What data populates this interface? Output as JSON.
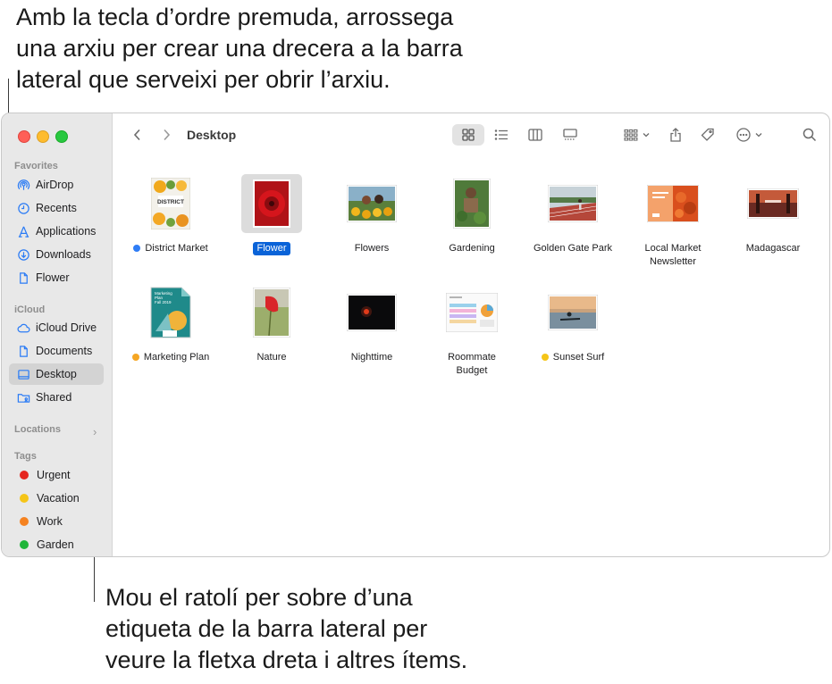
{
  "callouts": {
    "top": "Amb la tecla d’ordre premuda, arrossega\nuna arxiu per crear una drecera a la barra\nlateral que serveixi per obrir l’arxiu.",
    "bottom": "Mou el ratolí per sobre d’una\netiqueta de la barra lateral per\nveure la fletxa dreta i altres ítems."
  },
  "sidebar": {
    "favorites_heading": "Favorites",
    "favorites": [
      {
        "label": "AirDrop",
        "icon": "airdrop-icon"
      },
      {
        "label": "Recents",
        "icon": "clock-icon"
      },
      {
        "label": "Applications",
        "icon": "applications-icon"
      },
      {
        "label": "Downloads",
        "icon": "download-icon"
      },
      {
        "label": "Flower",
        "icon": "document-icon"
      }
    ],
    "icloud_heading": "iCloud",
    "icloud": [
      {
        "label": "iCloud Drive",
        "icon": "cloud-icon"
      },
      {
        "label": "Documents",
        "icon": "document-icon"
      },
      {
        "label": "Desktop",
        "icon": "desktop-icon",
        "active": true
      },
      {
        "label": "Shared",
        "icon": "shared-folder-icon"
      }
    ],
    "locations_heading": "Locations",
    "tags_heading": "Tags",
    "tags": [
      {
        "label": "Urgent",
        "color": "#e5261f"
      },
      {
        "label": "Vacation",
        "color": "#f5c518"
      },
      {
        "label": "Work",
        "color": "#f58220"
      },
      {
        "label": "Garden",
        "color": "#1fb53a"
      }
    ]
  },
  "toolbar": {
    "title": "Desktop"
  },
  "files": [
    {
      "label": "District Market",
      "tag_color": "#2f7df6"
    },
    {
      "label": "Flower",
      "selected": true
    },
    {
      "label": "Flowers"
    },
    {
      "label": "Gardening"
    },
    {
      "label": "Golden Gate Park"
    },
    {
      "label": "Local Market\nNewsletter"
    },
    {
      "label": "Madagascar"
    },
    {
      "label": "Marketing Plan",
      "tag_color": "#f5a623"
    },
    {
      "label": "Nature"
    },
    {
      "label": "Nighttime"
    },
    {
      "label": "Roommate\nBudget"
    },
    {
      "label": "Sunset Surf",
      "tag_color": "#f5c518"
    }
  ],
  "thumbnail_text": {
    "district": "DISTRICT",
    "marketing": "Marketing\nPlan\nFall 2019"
  }
}
